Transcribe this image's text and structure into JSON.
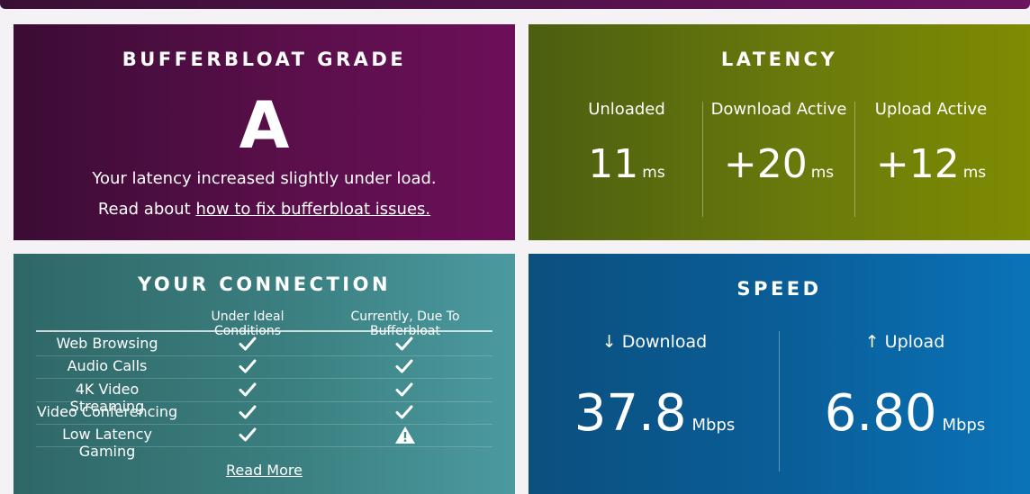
{
  "grade": {
    "title": "BUFFERBLOAT GRADE",
    "letter": "A",
    "message": "Your latency increased slightly under load.",
    "read_prefix": "Read about ",
    "read_link": "how to fix bufferbloat issues."
  },
  "latency": {
    "title": "LATENCY",
    "columns": [
      {
        "label": "Unloaded",
        "value": "11",
        "unit": "ms"
      },
      {
        "label": "Download Active",
        "value": "+20",
        "unit": "ms"
      },
      {
        "label": "Upload Active",
        "value": "+12",
        "unit": "ms"
      }
    ]
  },
  "connection": {
    "title": "YOUR CONNECTION",
    "header_ideal": "Under Ideal Conditions",
    "header_current": "Currently, Due To Bufferbloat",
    "rows": [
      {
        "label": "Web Browsing",
        "ideal": "check",
        "current": "check"
      },
      {
        "label": "Audio Calls",
        "ideal": "check",
        "current": "check"
      },
      {
        "label": "4K Video Streaming",
        "ideal": "check",
        "current": "check"
      },
      {
        "label": "Video Conferencing",
        "ideal": "check",
        "current": "check"
      },
      {
        "label": "Low Latency Gaming",
        "ideal": "check",
        "current": "warning"
      }
    ],
    "read_more": "Read More"
  },
  "speed": {
    "title": "SPEED",
    "download_label": "↓ Download",
    "download_value": "37.8",
    "download_unit": "Mbps",
    "upload_label": "↑ Upload",
    "upload_value": "6.80",
    "upload_unit": "Mbps"
  }
}
